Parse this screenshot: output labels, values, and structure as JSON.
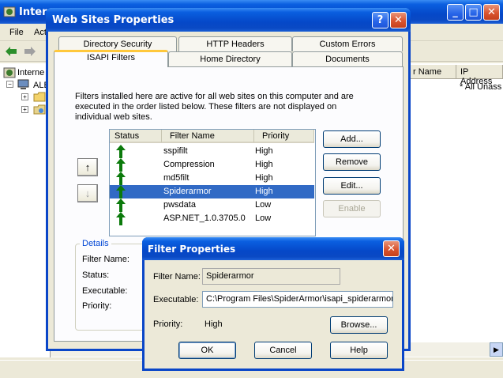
{
  "bg": {
    "title": "Intern",
    "menu": [
      "File",
      "Act"
    ],
    "tree": [
      "Interne",
      "ALB"
    ],
    "list_headers": [
      "r Name",
      "IP Address"
    ],
    "list_value": "* All Unass"
  },
  "dialog": {
    "title": "Web Sites Properties",
    "help_label": "?",
    "close_label": "✕",
    "tabs_top": [
      "Directory Security",
      "HTTP Headers",
      "Custom Errors"
    ],
    "tabs_bottom": [
      "ISAPI Filters",
      "Home Directory",
      "Documents"
    ],
    "active_tab": "ISAPI Filters",
    "description": "Filters installed here are active for all web sites on this computer and are executed in the order listed below.  These filters are not displayed on individual web sites.",
    "columns": [
      "Status",
      "Filter Name",
      "Priority"
    ],
    "filters": [
      {
        "name": "sspifilt",
        "priority": "High",
        "selected": false
      },
      {
        "name": "Compression",
        "priority": "High",
        "selected": false
      },
      {
        "name": "md5filt",
        "priority": "High",
        "selected": false
      },
      {
        "name": "Spiderarmor",
        "priority": "High",
        "selected": true
      },
      {
        "name": "pwsdata",
        "priority": "Low",
        "selected": false
      },
      {
        "name": "ASP.NET_1.0.3705.0",
        "priority": "Low",
        "selected": false
      }
    ],
    "move_up": "↑",
    "move_down": "↓",
    "buttons": {
      "add": "Add...",
      "remove": "Remove",
      "edit": "Edit...",
      "enable": "Enable"
    },
    "details": {
      "legend": "Details",
      "filter_name": "Filter Name:",
      "status": "Status:",
      "executable": "Executable:",
      "priority": "Priority:"
    }
  },
  "filter_props": {
    "title": "Filter Properties",
    "close_label": "✕",
    "filter_name_label": "Filter Name:",
    "filter_name_value": "Spiderarmor",
    "executable_label": "Executable:",
    "executable_value": "C:\\Program Files\\SpiderArmor\\isapi_spiderarmor.d",
    "priority_label": "Priority:",
    "priority_value": "High",
    "browse": "Browse...",
    "ok": "OK",
    "cancel": "Cancel",
    "help": "Help"
  },
  "colors": {
    "accent": "#0a46c8",
    "selection": "#316ac5",
    "status_arrow": "#0b7a0b"
  }
}
